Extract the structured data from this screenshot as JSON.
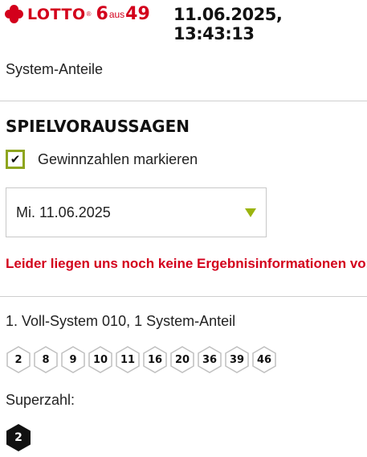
{
  "header": {
    "logo_text": "LOTTO",
    "logo_reg": "®",
    "logo_six": "6",
    "logo_aus": "aus",
    "logo_fortynine": "49",
    "datetime": "11.06.2025, 13:43:13"
  },
  "system_anteile_label": "System-Anteile",
  "section": {
    "title": "SPIELVORAUSSAGEN",
    "checkbox_label": "Gewinnzahlen markieren",
    "checkbox_checked": true
  },
  "date_select": {
    "value": "Mi. 11.06.2025",
    "arrow_color": "#9bb40e"
  },
  "error_message": "Leider liegen uns noch keine Ergebnisinformationen vor.",
  "system": {
    "description": "1. Voll-System 010, 1 System-Anteil",
    "numbers": [
      "2",
      "8",
      "9",
      "10",
      "11",
      "16",
      "20",
      "36",
      "39",
      "46"
    ]
  },
  "superzahl": {
    "label": "Superzahl:",
    "value": "2"
  },
  "colors": {
    "brand_red": "#d3001c",
    "accent_green": "#8ea51f"
  }
}
